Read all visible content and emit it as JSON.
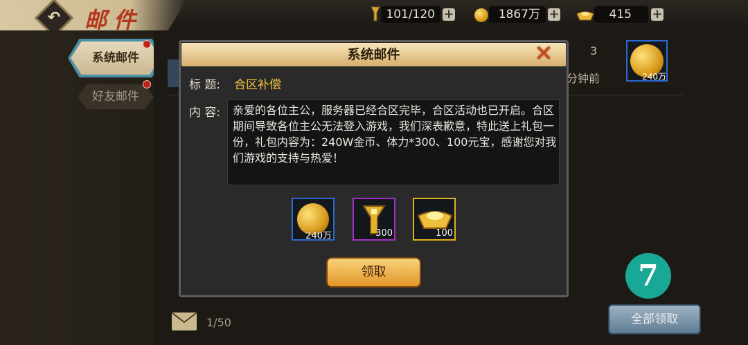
{
  "header": {
    "title": "邮件",
    "stamina": "101/120",
    "gold": "1867万",
    "ingots": "415"
  },
  "sidebar": {
    "tabs": [
      {
        "label": "系统邮件",
        "active": true
      },
      {
        "label": "好友邮件",
        "active": false
      }
    ]
  },
  "mail_list": {
    "row_count": "3",
    "row_time": "分钟前",
    "row_attachment_label": "240万",
    "footer_count": "1/50",
    "claim_all_label": "全部领取"
  },
  "floating_badge": "7",
  "dialog": {
    "title": "系统邮件",
    "subject_label": "标 题:",
    "subject": "合区补偿",
    "content_label": "内 容:",
    "content": "亲爱的各位主公，服务器已经合区完毕，合区活动也已开启。合区期间导致各位主公无法登入游戏，我们深表歉意，特此送上礼包一份，礼包内容为：240W金币、体力*300、100元宝，感谢您对我们游戏的支持与热爱！",
    "rewards": [
      {
        "icon": "gold-coin-icon",
        "count": "240万",
        "border": "#2b6bd0"
      },
      {
        "icon": "stamina-torch-icon",
        "count": "300",
        "border": "#a432c8"
      },
      {
        "icon": "gold-ingot-icon",
        "count": "100",
        "border": "#e0b21a"
      }
    ],
    "claim_label": "领取"
  }
}
